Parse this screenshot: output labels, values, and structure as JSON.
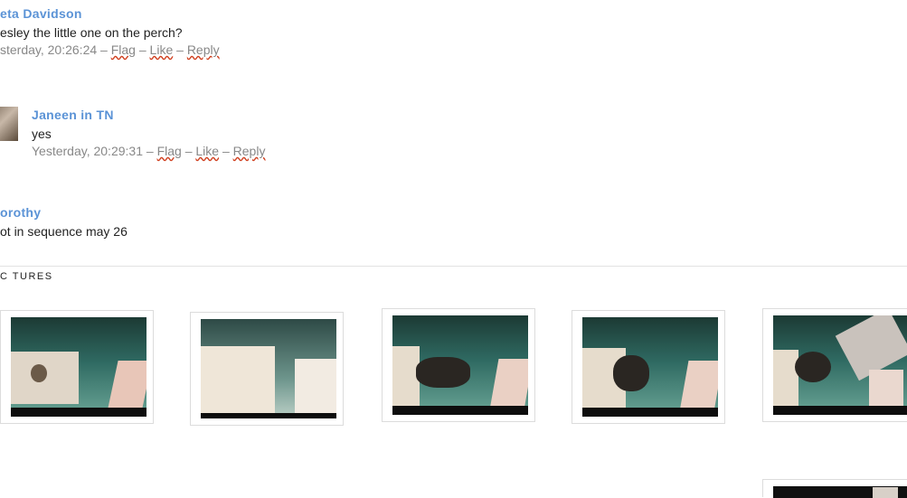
{
  "comments": [
    {
      "author": "eta Davidson",
      "text": "esley the little one on the perch?",
      "time": "sterday, 20:26:24",
      "flag": "Flag",
      "like": "Like",
      "reply": "Reply"
    },
    {
      "author": "Janeen in TN",
      "text": "yes",
      "time": "Yesterday, 20:29:31",
      "flag": "Flag",
      "like": "Like",
      "reply": "Reply"
    },
    {
      "author": "orothy",
      "text": "ot in sequence may 26"
    }
  ],
  "separator": " – ",
  "section_title": "C TURES",
  "thumbnails": [
    {
      "icon": "webcam-snapshot-1"
    },
    {
      "icon": "webcam-snapshot-2"
    },
    {
      "icon": "webcam-snapshot-3"
    },
    {
      "icon": "webcam-snapshot-4"
    },
    {
      "icon": "webcam-snapshot-5"
    }
  ]
}
